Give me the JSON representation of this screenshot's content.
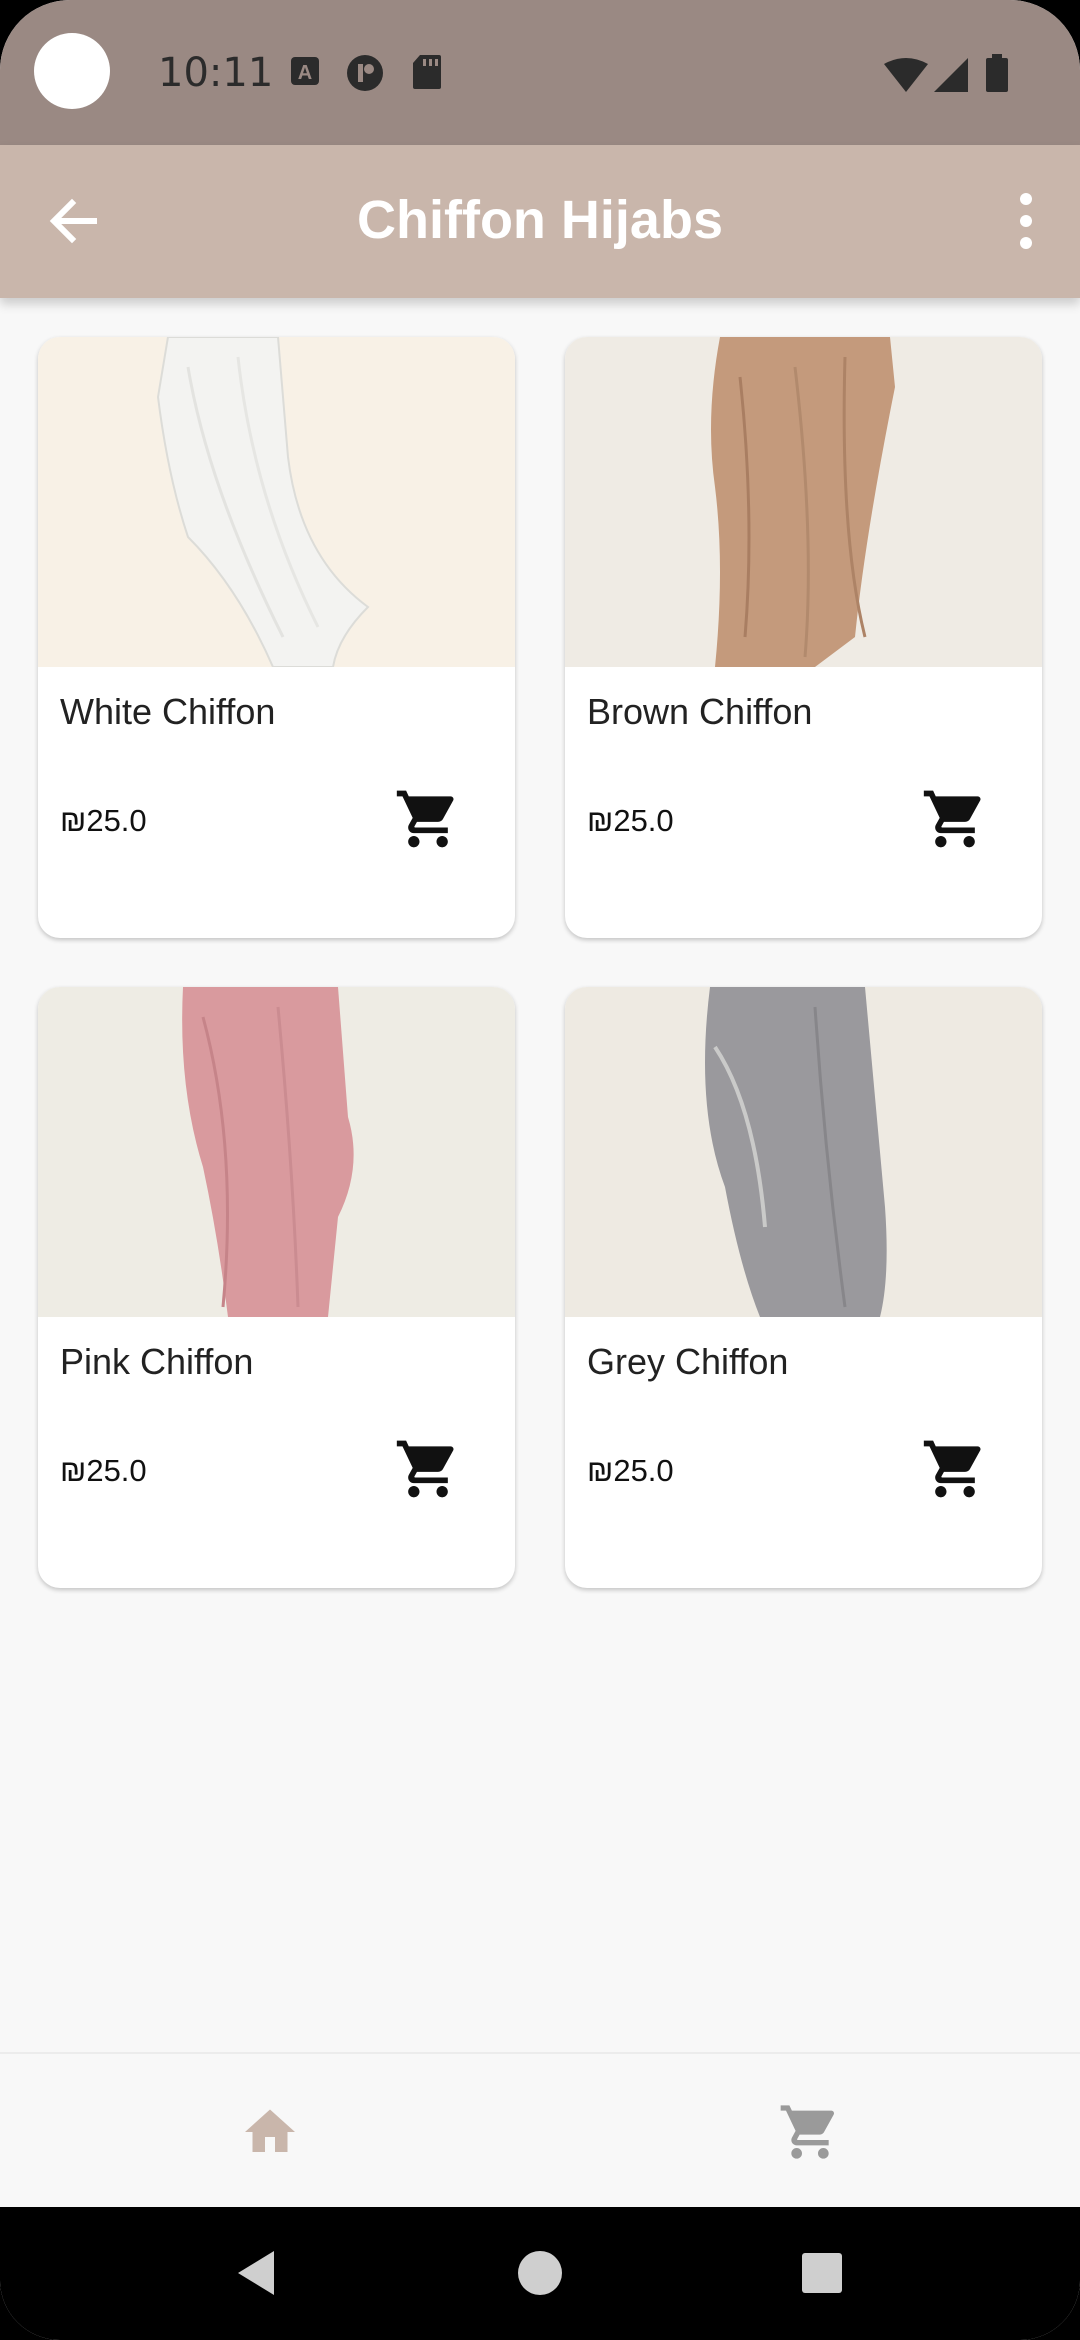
{
  "status_bar": {
    "time": "10:11",
    "icons_left": [
      "a-badge-icon",
      "at-sign-icon",
      "sd-card-icon"
    ],
    "icons_right": [
      "wifi-icon",
      "signal-icon",
      "battery-icon"
    ]
  },
  "app_bar": {
    "title": "Chiffon Hijabs",
    "back_icon": "arrow-left-icon",
    "menu_icon": "more-vert-icon"
  },
  "products": [
    {
      "name": "White Chiffon",
      "price": "₪25.0",
      "cart_icon": "cart-icon",
      "bg": "#f8f1e6",
      "fabric": "#f3f3f1"
    },
    {
      "name": "Brown Chiffon",
      "price": "₪25.0",
      "cart_icon": "cart-icon",
      "bg": "#efebe4",
      "fabric": "#c49a7c"
    },
    {
      "name": "Pink Chiffon",
      "price": "₪25.0",
      "cart_icon": "cart-icon",
      "bg": "#eeece4",
      "fabric": "#d99a9e"
    },
    {
      "name": "Grey Chiffon",
      "price": "₪25.0",
      "cart_icon": "cart-icon",
      "bg": "#eeeae2",
      "fabric": "#9a999d"
    }
  ],
  "bottom_nav": {
    "items": [
      {
        "icon": "home-icon",
        "color": "#c9b6ab"
      },
      {
        "icon": "cart-icon",
        "color": "#9a9a9a"
      }
    ]
  },
  "colors": {
    "status_bar": "#9a8983",
    "app_bar": "#c9b6ab",
    "background": "#f8f8f8"
  }
}
